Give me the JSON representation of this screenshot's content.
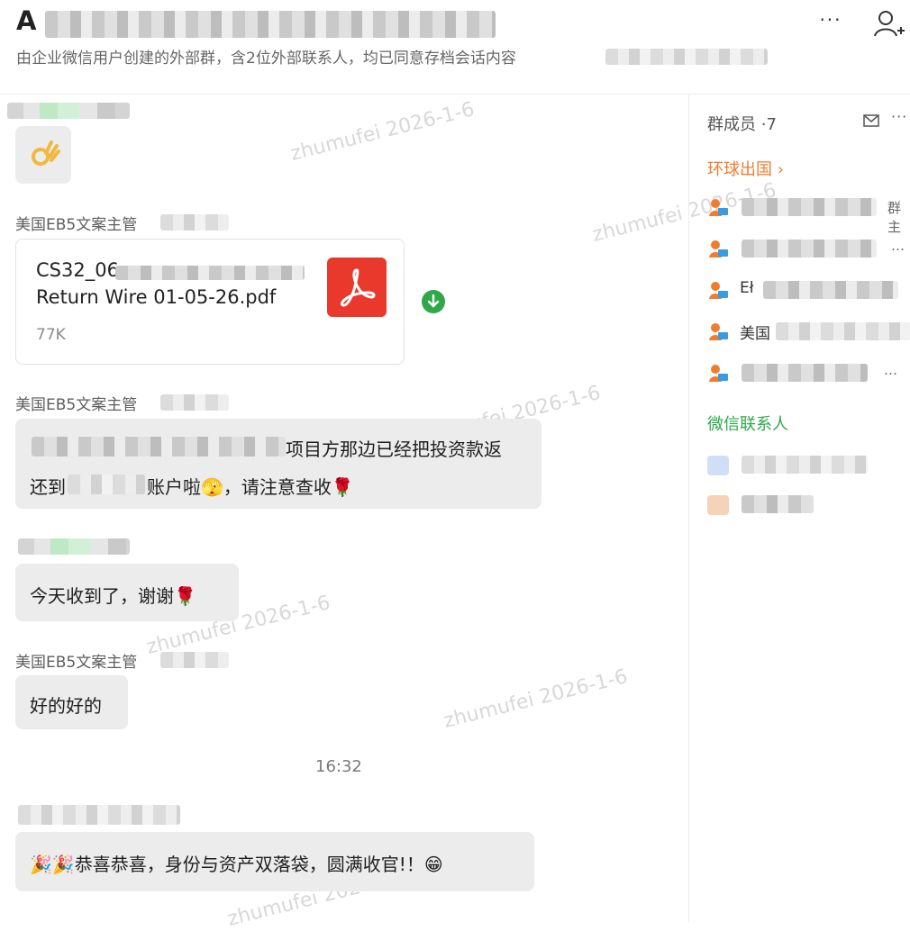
{
  "header": {
    "title": "A",
    "subtitle": "由企业微信用户创建的外部群，含2位外部联系人，均已同意存档会话内容",
    "more_label": "···"
  },
  "chat": {
    "file": {
      "name_line1": "CS32_06",
      "name_line2": "Return Wire 01-05-26.pdf",
      "size": "77K"
    },
    "sender_visible": "美国EB5文案主管",
    "msg_returned_part1": "项目方那边已经把投资款返",
    "msg_returned_part2_prefix": "还到",
    "msg_returned_part2_suffix": "账户啦🫣，请注意查收🌹",
    "msg_received": "今天收到了，谢谢🌹",
    "msg_ok": "好的好的",
    "timestamp": "16:32",
    "msg_congrats": "🎉🎉恭喜恭喜，身份与资产双落袋，圆满收官!！😁",
    "watermark": "zhumufei 2026-1-6"
  },
  "sidebar": {
    "members_title": "群成员 ·7",
    "more_label": "···",
    "group_company": "环球出国 ›",
    "group_wechat": "微信联系人",
    "member_tails": [
      "群主",
      "…",
      "Eł",
      "美国",
      "…"
    ]
  },
  "colors": {
    "accent_orange": "#f07c2e",
    "wechat_green": "#2ea84a",
    "pdf_red": "#e8392c",
    "bubble_grey": "#ececec"
  }
}
